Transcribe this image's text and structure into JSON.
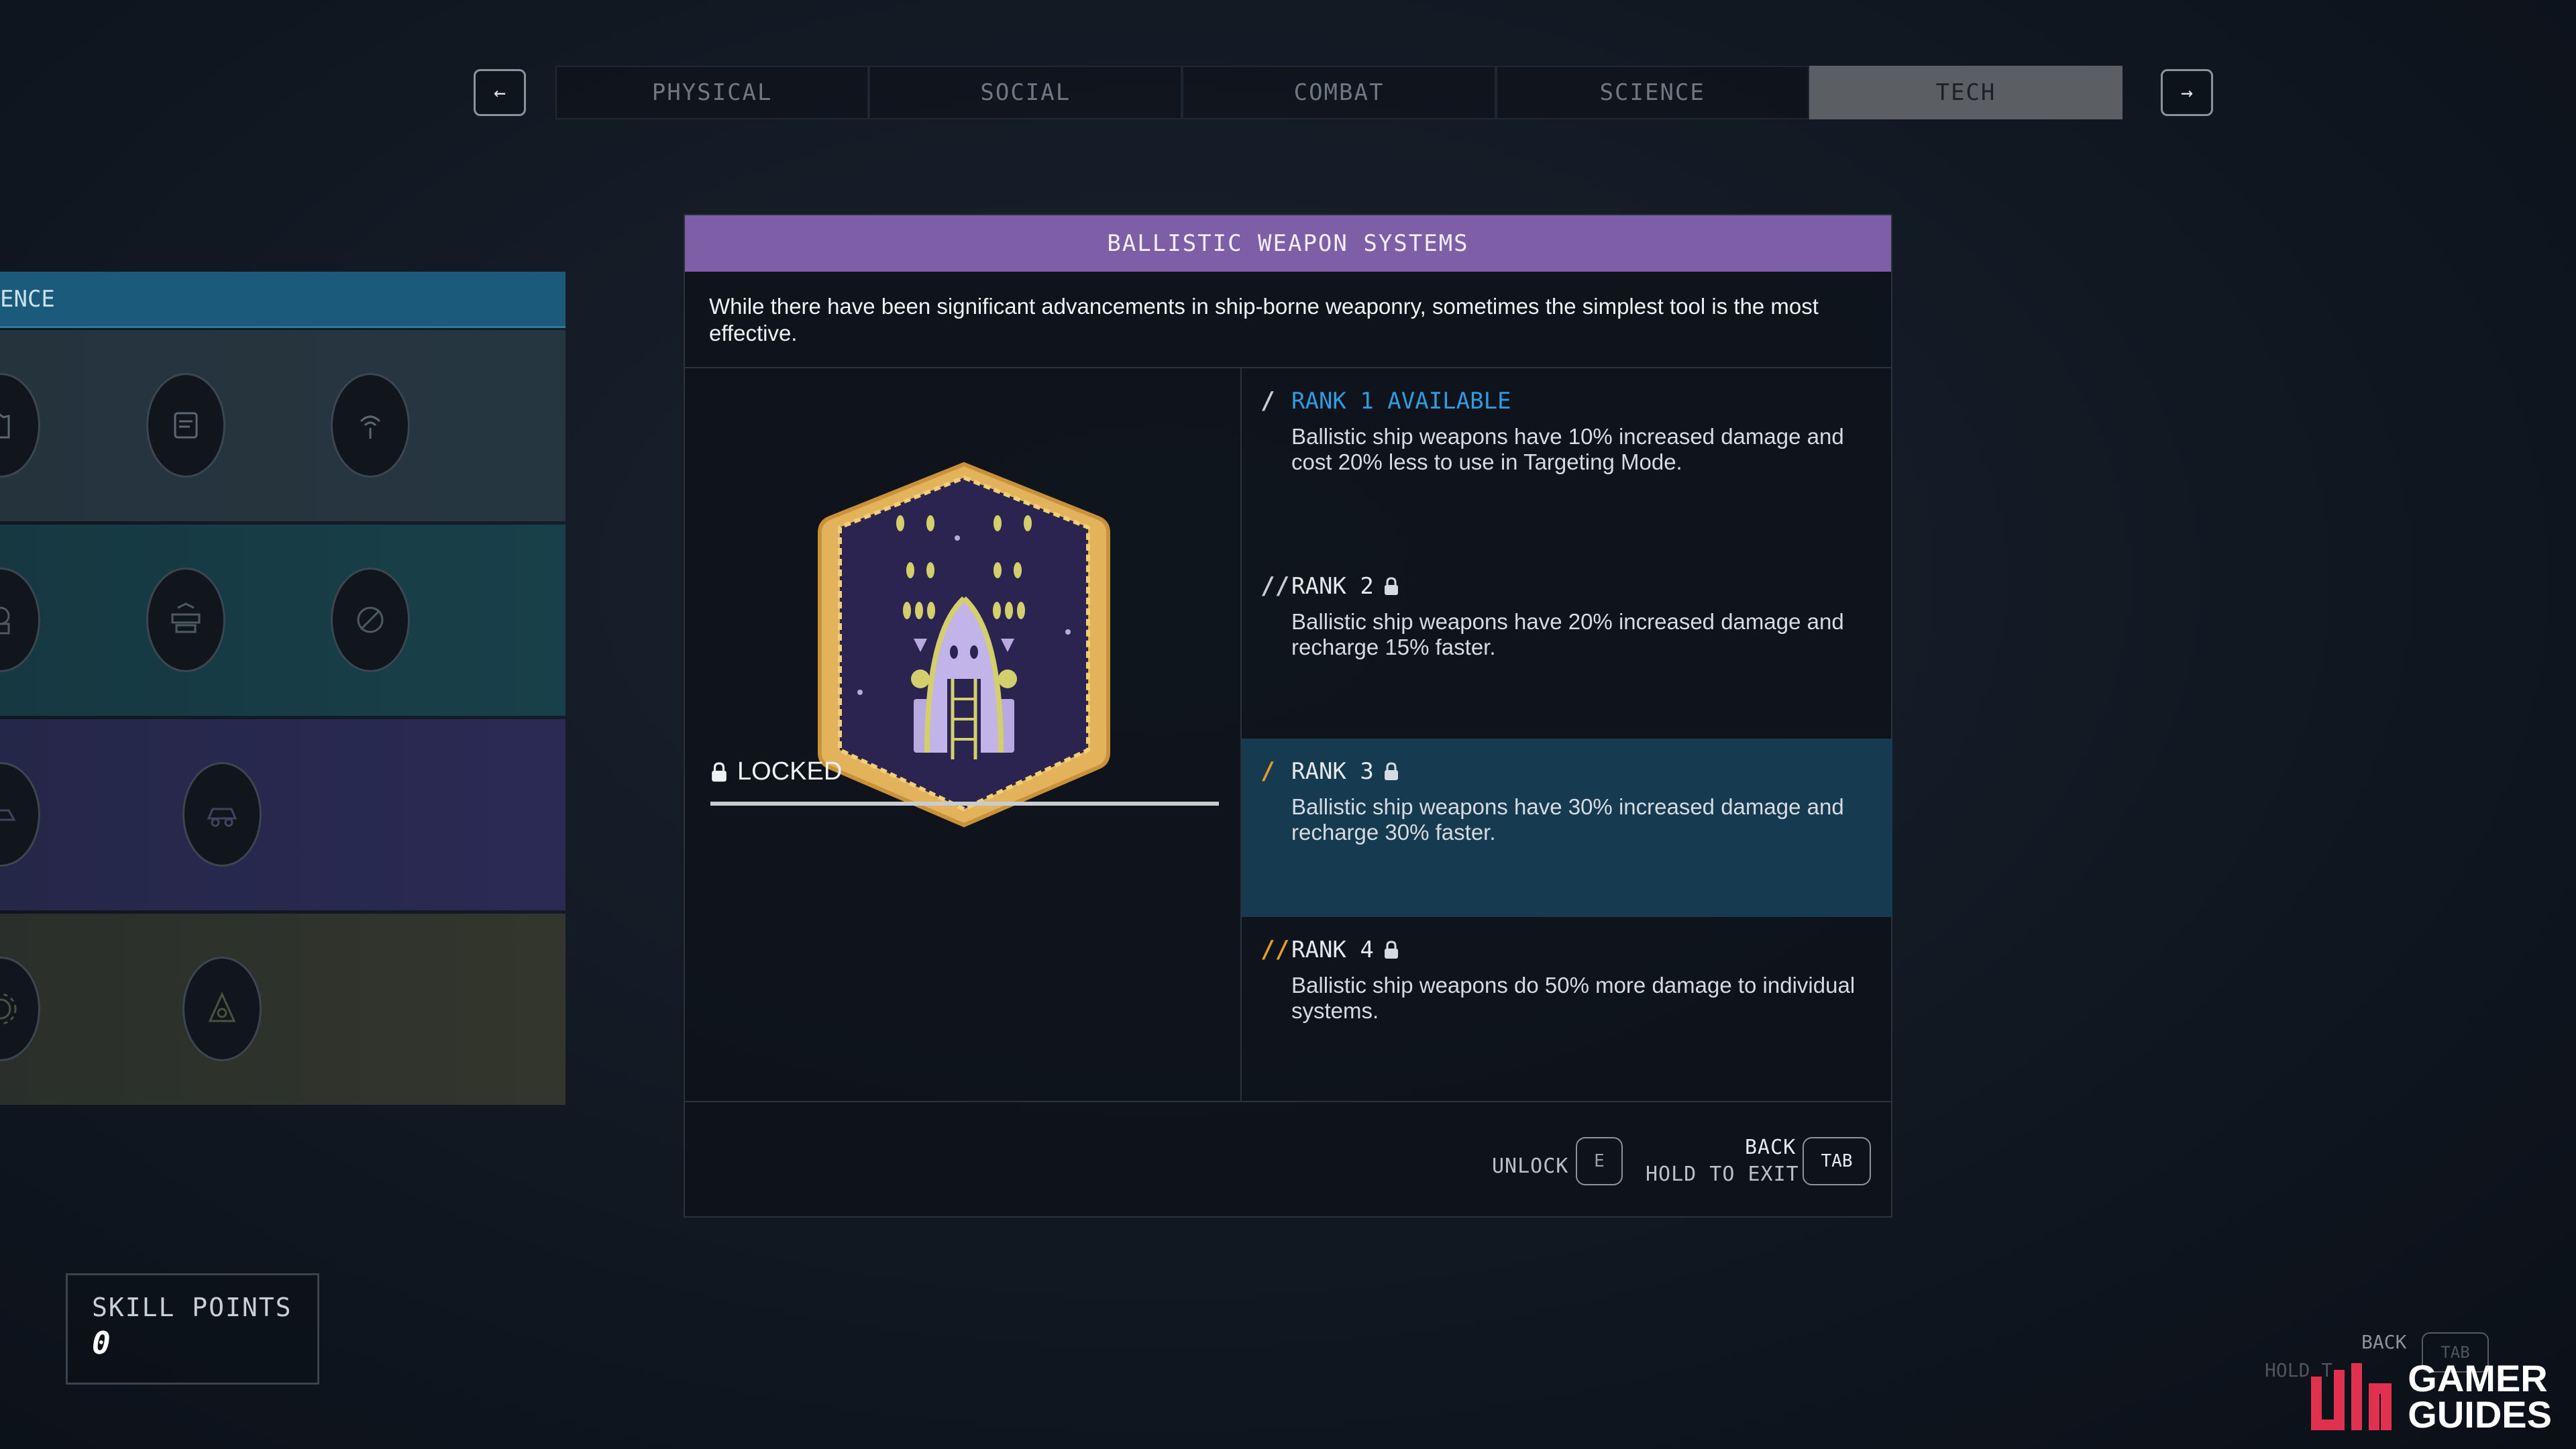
{
  "tabs": {
    "prev_icon": "arrow-left-icon",
    "next_icon": "arrow-right-icon",
    "items": [
      "PHYSICAL",
      "SOCIAL",
      "COMBAT",
      "SCIENCE",
      "TECH"
    ],
    "active": "TECH"
  },
  "tree": {
    "header": "ENCE"
  },
  "skill": {
    "title": "BALLISTIC WEAPON SYSTEMS",
    "description": "While there have been significant advancements in ship-borne weaponry, sometimes the simplest tool is the most effective.",
    "status": "LOCKED",
    "ranks": [
      {
        "label": "RANK 1 AVAILABLE",
        "text": "Ballistic ship weapons have 10% increased damage and cost 20% less to use in Targeting Mode.",
        "color": "#2f9be0"
      },
      {
        "label": "RANK 2",
        "text": "Ballistic ship weapons have 20% increased damage and recharge 15% faster.",
        "color": "#c7ccd1"
      },
      {
        "label": "RANK 3",
        "text": "Ballistic ship weapons have 30% increased damage and recharge 30% faster.",
        "color": "#e39b2a"
      },
      {
        "label": "RANK 4",
        "text": "Ballistic ship weapons do 50% more damage to individual systems.",
        "color": "#e39b2a"
      }
    ]
  },
  "footer": {
    "unlock_label": "UNLOCK",
    "unlock_key": "E",
    "back_label": "BACK",
    "hold_label": "HOLD TO EXIT",
    "back_key": "TAB"
  },
  "skill_points": {
    "label": "SKILL POINTS",
    "value": "0"
  },
  "ghost_hint": {
    "back": "BACK",
    "hold": "HOLD T",
    "key": "TAB"
  },
  "watermark": {
    "line1": "GAMER",
    "line2": "GUIDES"
  },
  "colors": {
    "title_bar": "#7e5ea6",
    "active_tab": "#5b5f63",
    "available": "#2f9be0",
    "rank_highlight": "#163a50"
  }
}
